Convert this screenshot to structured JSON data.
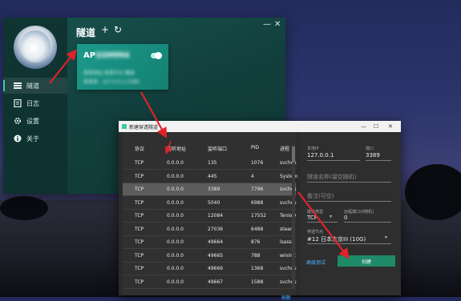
{
  "app": {
    "title": "隧道",
    "nav": [
      {
        "label": "隧道",
        "icon": "tunnel-list-icon",
        "active": true
      },
      {
        "label": "日志",
        "icon": "log-icon",
        "active": false
      },
      {
        "label": "设置",
        "icon": "gear-icon",
        "active": false
      },
      {
        "label": "关于",
        "icon": "info-icon",
        "active": false
      }
    ],
    "add_icon": "+",
    "refresh_icon": "↻",
    "minimize_icon": "—",
    "close_icon": "✕",
    "card": {
      "name_prefix": "AP",
      "name_blurred": "SOMM4",
      "line1": "某某地址 某某节点 隧道",
      "line2": "某某某 · 127.0.0.1:3389",
      "toggle_on": true
    }
  },
  "dialog": {
    "title": "新建穿透隧道",
    "columns": [
      "协议",
      "监听地址",
      "监听端口",
      "PID",
      "进程"
    ],
    "rows": [
      [
        "TCP",
        "0.0.0.0",
        "135",
        "1076",
        "svchos"
      ],
      [
        "TCP",
        "0.0.0.0",
        "445",
        "4",
        "System"
      ],
      [
        "TCP",
        "0.0.0.0",
        "3389",
        "7796",
        "svchos"
      ],
      [
        "TCP",
        "0.0.0.0",
        "5040",
        "6988",
        "svchos"
      ],
      [
        "TCP",
        "0.0.0.0",
        "12084",
        "17552",
        "TenioD"
      ],
      [
        "TCP",
        "0.0.0.0",
        "27036",
        "6488",
        "steam"
      ],
      [
        "TCP",
        "0.0.0.0",
        "49664",
        "876",
        "lsass"
      ],
      [
        "TCP",
        "0.0.0.0",
        "49665",
        "788",
        "wininit"
      ],
      [
        "TCP",
        "0.0.0.0",
        "49666",
        "1368",
        "svchos"
      ],
      [
        "TCP",
        "0.0.0.0",
        "49667",
        "1588",
        "svchos"
      ]
    ],
    "selected_row": 2,
    "refresh_label": "刷新",
    "form": {
      "local_ip_label": "本地IP",
      "local_ip": "127.0.0.1",
      "port_label": "端口",
      "port": "3389",
      "name_placeholder": "隧道名称(留空随机)",
      "remark_placeholder": "备注(可空)",
      "type_label": "隧道类型",
      "type_value": "TCP",
      "remote_port_label": "远程端口(0随机)",
      "remote_port": "0",
      "node_label": "穿透节点",
      "node_value": "#12 日本东京III (10G)",
      "advanced_label": "高级测试",
      "create_label": "创建"
    }
  },
  "colors": {
    "arrow": "#e0222a",
    "accent": "#3ec9a7",
    "create_button": "#1f8a68",
    "link": "#4fb7ff"
  }
}
